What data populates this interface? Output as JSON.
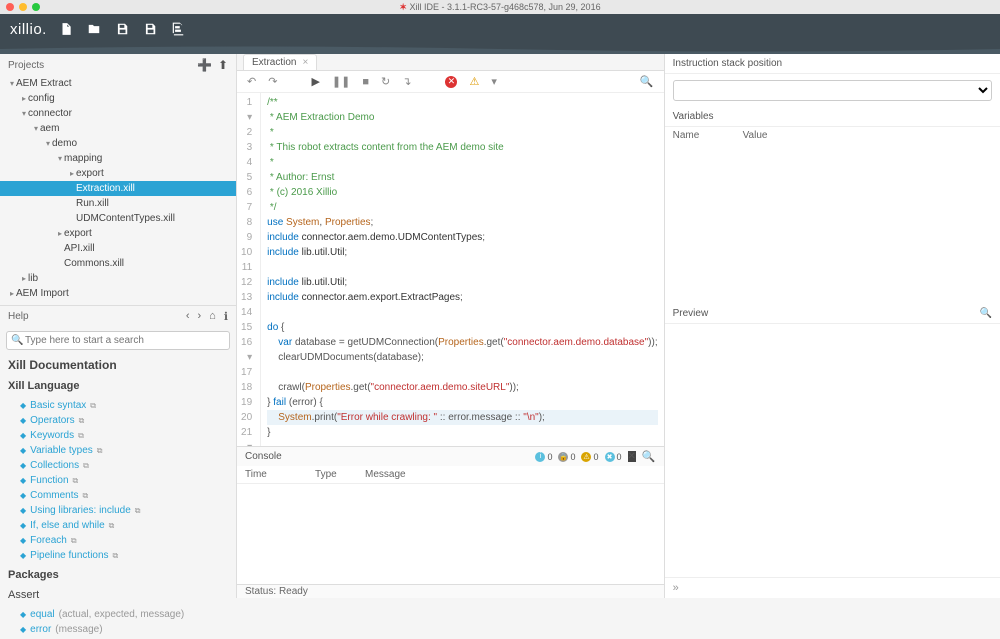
{
  "window": {
    "title": "Xill IDE - 3.1.1-RC3-57-g468c578, Jun 29, 2016"
  },
  "brand": "xillio.",
  "sidebar": {
    "projects_label": "Projects",
    "tree": [
      {
        "label": "AEM Extract",
        "depth": 0,
        "expanded": true
      },
      {
        "label": "config",
        "depth": 1,
        "expanded": false
      },
      {
        "label": "connector",
        "depth": 1,
        "expanded": true
      },
      {
        "label": "aem",
        "depth": 2,
        "expanded": true
      },
      {
        "label": "demo",
        "depth": 3,
        "expanded": true
      },
      {
        "label": "mapping",
        "depth": 4,
        "expanded": true
      },
      {
        "label": "export",
        "depth": 5,
        "expanded": false
      },
      {
        "label": "Extraction.xill",
        "depth": 5,
        "expanded": null,
        "selected": true
      },
      {
        "label": "Run.xill",
        "depth": 5,
        "expanded": null
      },
      {
        "label": "UDMContentTypes.xill",
        "depth": 5,
        "expanded": null
      },
      {
        "label": "export",
        "depth": 4,
        "expanded": false
      },
      {
        "label": "API.xill",
        "depth": 4,
        "expanded": null
      },
      {
        "label": "Commons.xill",
        "depth": 4,
        "expanded": null
      },
      {
        "label": "lib",
        "depth": 1,
        "expanded": false
      },
      {
        "label": "AEM Import",
        "depth": 0,
        "expanded": false
      }
    ],
    "help_label": "Help",
    "search_placeholder": "Type here to start a search",
    "doc_header": "Xill Documentation",
    "lang_header": "Xill Language",
    "doc_items": [
      "Basic syntax",
      "Operators",
      "Keywords",
      "Variable types",
      "Collections",
      "Function",
      "Comments",
      "Using libraries: include",
      "If, else and while",
      "Foreach",
      "Pipeline functions"
    ],
    "packages_header": "Packages",
    "assert_header": "Assert",
    "assert_items": [
      {
        "fn": "equal",
        "sig": "(actual, expected, message)"
      },
      {
        "fn": "error",
        "sig": "(message)"
      }
    ]
  },
  "tabs": [
    {
      "label": "Extraction"
    }
  ],
  "code_lines": [
    {
      "n": 1,
      "mark": "▾",
      "html": "<span class='c-comment'>/**</span>"
    },
    {
      "n": 2,
      "html": "<span class='c-comment'> * AEM Extraction Demo</span>"
    },
    {
      "n": 3,
      "html": "<span class='c-comment'> *</span>"
    },
    {
      "n": 4,
      "html": "<span class='c-comment'> * This robot extracts content from the AEM demo site</span>"
    },
    {
      "n": 5,
      "html": "<span class='c-comment'> *</span>"
    },
    {
      "n": 6,
      "html": "<span class='c-comment'> * Author: Ernst</span>"
    },
    {
      "n": 7,
      "html": "<span class='c-comment'> * (c) 2016 Xillio</span>"
    },
    {
      "n": 8,
      "html": "<span class='c-comment'> */</span>"
    },
    {
      "n": 9,
      "html": "<span class='c-key'>use</span> <span class='c-type'>System</span><span class='c-punct'>,</span> <span class='c-type'>Properties</span><span class='c-punct'>;</span>"
    },
    {
      "n": 10,
      "html": "<span class='c-key'>include</span> <span class='c-ident'>connector.aem.demo.UDMContentTypes</span><span class='c-punct'>;</span>"
    },
    {
      "n": 11,
      "html": "<span class='c-key'>include</span> <span class='c-ident'>lib.util.Util</span><span class='c-punct'>;</span>"
    },
    {
      "n": 12,
      "html": ""
    },
    {
      "n": 13,
      "html": "<span class='c-key'>include</span> <span class='c-ident'>lib.util.Util</span><span class='c-punct'>;</span>"
    },
    {
      "n": 14,
      "html": "<span class='c-key'>include</span> <span class='c-ident'>connector.aem.export.ExtractPages</span><span class='c-punct'>;</span>"
    },
    {
      "n": 15,
      "html": ""
    },
    {
      "n": 16,
      "mark": "▾",
      "html": "<span class='c-key'>do</span> <span class='c-punct'>{</span>"
    },
    {
      "n": 17,
      "html": "    <span class='c-key'>var</span> database <span class='c-punct'>=</span> getUDMConnection<span class='c-punct'>(</span><span class='c-type'>Properties</span>.get<span class='c-punct'>(</span><span class='c-str'>\"connector.aem.demo.database\"</span><span class='c-punct'>));</span>"
    },
    {
      "n": 18,
      "html": "    clearUDMDocuments<span class='c-punct'>(</span>database<span class='c-punct'>);</span>"
    },
    {
      "n": 19,
      "html": ""
    },
    {
      "n": 20,
      "html": "    crawl<span class='c-punct'>(</span><span class='c-type'>Properties</span>.get<span class='c-punct'>(</span><span class='c-str'>\"connector.aem.demo.siteURL\"</span><span class='c-punct'>));</span>"
    },
    {
      "n": 21,
      "mark": "▾",
      "html": "<span class='c-punct'>}</span> <span class='c-key'>fail</span> <span class='c-punct'>(</span>error<span class='c-punct'>)</span> <span class='c-punct'>{</span>"
    },
    {
      "n": 22,
      "hl": true,
      "html": "    <span class='c-type'>System</span>.print<span class='c-punct'>(</span><span class='c-str'>\"Error while crawling: \"</span> <span class='c-punct'>::</span> error.message <span class='c-punct'>::</span> <span class='c-str'>\"\\n\"</span><span class='c-punct'>);</span>"
    },
    {
      "n": 23,
      "html": "<span class='c-punct'>}</span>"
    }
  ],
  "console": {
    "label": "Console",
    "cols": {
      "time": "Time",
      "type": "Type",
      "message": "Message"
    },
    "badges": {
      "info": "0",
      "lock": "0",
      "warn": "0",
      "err": "0"
    }
  },
  "status": {
    "label": "Status:",
    "value": "Ready"
  },
  "right": {
    "stack_label": "Instruction stack position",
    "vars_label": "Variables",
    "var_cols": {
      "name": "Name",
      "value": "Value"
    },
    "preview_label": "Preview"
  }
}
